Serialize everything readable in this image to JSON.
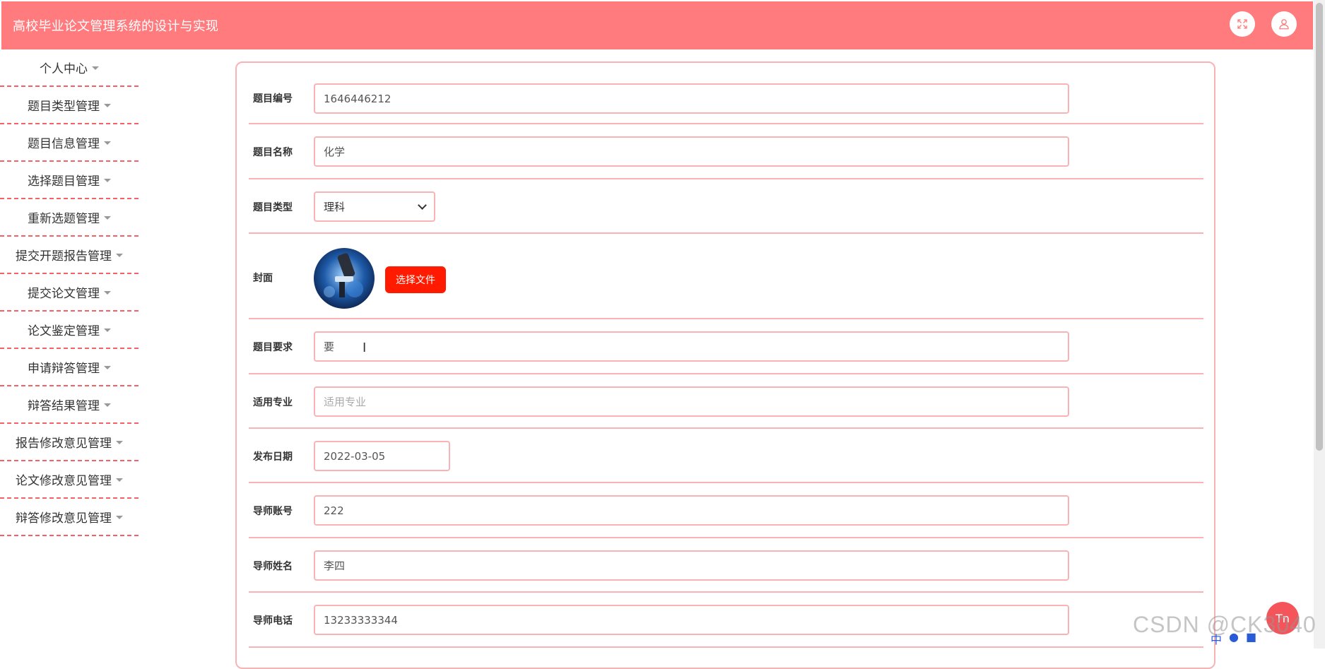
{
  "header": {
    "title": "高校毕业论文管理系统的设计与实现",
    "fullscreen_icon": "fullscreen-icon",
    "user_icon": "user-icon"
  },
  "sidebar": {
    "items": [
      {
        "label": "个人中心"
      },
      {
        "label": "题目类型管理"
      },
      {
        "label": "题目信息管理"
      },
      {
        "label": "选择题目管理"
      },
      {
        "label": "重新选题管理"
      },
      {
        "label": "提交开题报告管理"
      },
      {
        "label": "提交论文管理"
      },
      {
        "label": "论文鉴定管理"
      },
      {
        "label": "申请辩答管理"
      },
      {
        "label": "辩答结果管理"
      },
      {
        "label": "报告修改意见管理"
      },
      {
        "label": "论文修改意见管理"
      },
      {
        "label": "辩答修改意见管理"
      }
    ]
  },
  "form": {
    "topic_no": {
      "label": "题目编号",
      "value": "1646446212"
    },
    "topic_name": {
      "label": "题目名称",
      "value": "化学"
    },
    "topic_type": {
      "label": "题目类型",
      "value": "理科"
    },
    "cover": {
      "label": "封面",
      "button": "选择文件"
    },
    "requirement": {
      "label": "题目要求",
      "value": "要"
    },
    "major": {
      "label": "适用专业",
      "value": "",
      "placeholder": "适用专业"
    },
    "publish_date": {
      "label": "发布日期",
      "value": "2022-03-05"
    },
    "tutor_account": {
      "label": "导师账号",
      "value": "222"
    },
    "tutor_name": {
      "label": "导师姓名",
      "value": "李四"
    },
    "tutor_phone": {
      "label": "导师电话",
      "value": "13233333344"
    }
  },
  "overlay": {
    "float_button": "Tn",
    "watermark": "CSDN @CK3040",
    "tray_ime": "中"
  },
  "colors": {
    "header_bg": "#ff7b7e",
    "border": "#f9b3b4",
    "dashed": "#f06467",
    "primary_button": "#ff1a00"
  }
}
